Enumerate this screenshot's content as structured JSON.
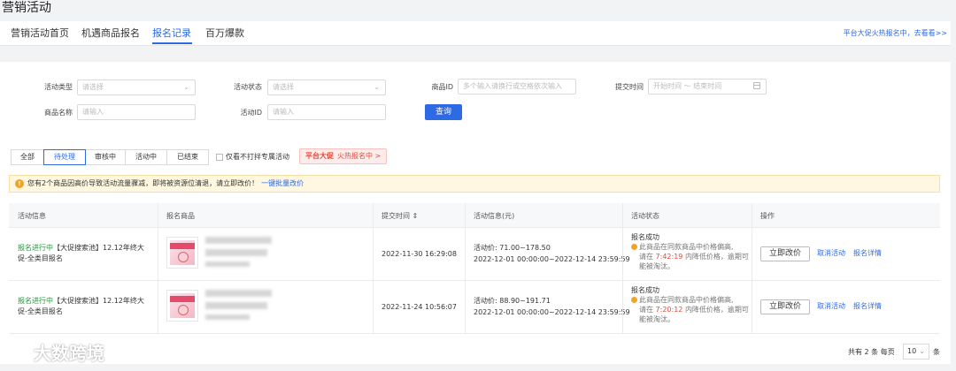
{
  "page_title": "营销活动",
  "tabs": [
    {
      "label": "营销活动首页"
    },
    {
      "label": "机遇商品报名"
    },
    {
      "label": "报名记录"
    },
    {
      "label": "百万爆款"
    }
  ],
  "promo_link": "平台大促火热报名中，去看看>>",
  "filters": {
    "activity_type": {
      "label": "活动类型",
      "placeholder": "请选择"
    },
    "activity_status": {
      "label": "活动状态",
      "placeholder": "请选择"
    },
    "product_id": {
      "label": "商品ID",
      "placeholder": "多个输入请换行或空格依次输入"
    },
    "submit_time": {
      "label": "提交时间",
      "start": "开始时间",
      "separator": "～",
      "end": "结束时间"
    },
    "product_name": {
      "label": "商品名称",
      "placeholder": "请输入"
    },
    "activity_id": {
      "label": "活动ID",
      "placeholder": "请输入"
    },
    "query_button": "查询"
  },
  "status_tabs": [
    "全部",
    "待处理",
    "审核中",
    "活动中",
    "已结束"
  ],
  "checkbox_label": "仅看不打拌专属活动",
  "hot_badge": {
    "strong": "平台大促",
    "text": "火热报名中 >"
  },
  "alert": {
    "text": "您有2个商品因高价导致活动流量骤减，即将被资源位清退，请立即改价！",
    "link": "一键批量改价"
  },
  "table": {
    "headers": [
      "活动信息",
      "报名商品",
      "提交时间 ⇕",
      "活动信息(元)",
      "活动状态",
      "操作"
    ],
    "rows": [
      {
        "status": "报名进行中",
        "activity": "【大促搜索池】12.12年终大促-全类目报名",
        "submit_time": "2022-11-30 16:29:08",
        "price": "活动价: 71.00~178.50",
        "period": "2022-12-01 00:00:00~2022-12-14 23:59:59",
        "result": "报名成功",
        "note1": "此商品在同款商品中价格偏高,",
        "note2_pre": "请在",
        "countdown": "7:42:19",
        "note2_post": "内降低价格，逾期可",
        "note3": "能被淘汰。",
        "btn": "立即改价",
        "cancel": "取消活动",
        "detail": "报名详情"
      },
      {
        "status": "报名进行中",
        "activity": "【大促搜索池】12.12年终大促-全类目报名",
        "submit_time": "2022-11-24 10:56:07",
        "price": "活动价: 88.90~191.71",
        "period": "2022-12-01 00:00:00~2022-12-14 23:59:59",
        "result": "报名成功",
        "note1": "此商品在同款商品中价格偏高,",
        "note2_pre": "请在",
        "countdown": "7:20:12",
        "note2_post": "内降低价格，逾期可",
        "note3": "能被淘汰。",
        "btn": "立即改价",
        "cancel": "取消活动",
        "detail": "报名详情"
      }
    ]
  },
  "pager": {
    "total": "共有 2 条",
    "per_page_label": "每页",
    "per_page": "10",
    "unit": "条"
  },
  "watermark_logo": "大数跨境",
  "colors": {
    "accent": "#2d6ae3",
    "success": "#1f9d3a",
    "danger": "#e5483a",
    "warning": "#f3a326"
  }
}
